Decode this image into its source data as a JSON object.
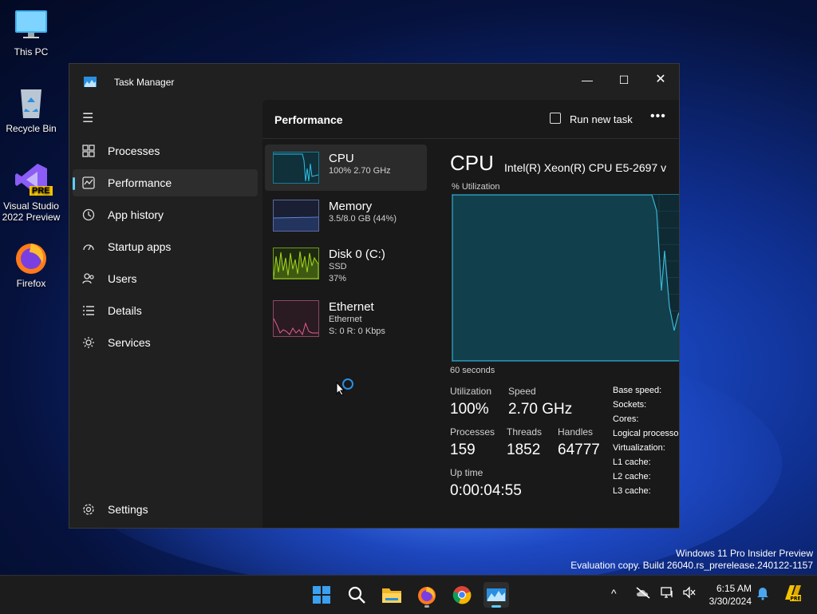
{
  "desktop": {
    "icons": [
      {
        "label": "This PC"
      },
      {
        "label": "Recycle Bin"
      },
      {
        "label": "Visual Studio 2022 Preview",
        "badge": "PRE"
      },
      {
        "label": "Firefox"
      }
    ],
    "watermark": {
      "line1": "Windows 11 Pro Insider Preview",
      "line2": "Evaluation copy. Build 26040.rs_prerelease.240122-1157"
    }
  },
  "window": {
    "title": "Task Manager",
    "controls": {
      "minimize": "—",
      "maximize": "☐",
      "close": "✕"
    }
  },
  "nav": {
    "hamburger": "☰",
    "items": [
      {
        "label": "Processes",
        "icon": "processes-grid-icon"
      },
      {
        "label": "Performance",
        "icon": "performance-chart-icon",
        "active": true
      },
      {
        "label": "App history",
        "icon": "history-clock-icon"
      },
      {
        "label": "Startup apps",
        "icon": "startup-gauge-icon"
      },
      {
        "label": "Users",
        "icon": "users-icon"
      },
      {
        "label": "Details",
        "icon": "details-list-icon"
      },
      {
        "label": "Services",
        "icon": "services-puzzle-icon"
      }
    ],
    "settings": "Settings"
  },
  "header": {
    "page_title": "Performance",
    "run_new_task": "Run new task",
    "more": "•••"
  },
  "resources": [
    {
      "name": "CPU",
      "sub1": "100%  2.70 GHz",
      "sub2": ""
    },
    {
      "name": "Memory",
      "sub1": "3.5/8.0 GB (44%)",
      "sub2": ""
    },
    {
      "name": "Disk 0 (C:)",
      "sub1": "SSD",
      "sub2": "37%"
    },
    {
      "name": "Ethernet",
      "sub1": "Ethernet",
      "sub2": "S: 0  R: 0 Kbps"
    }
  ],
  "detail": {
    "title": "CPU",
    "model": "Intel(R) Xeon(R) CPU E5-2697 v",
    "graph_label": "% Utilization",
    "time_label": "60 seconds",
    "utilization_label": "Utilization",
    "utilization_value": "100%",
    "speed_label": "Speed",
    "speed_value": "2.70 GHz",
    "processes_label": "Processes",
    "processes_value": "159",
    "threads_label": "Threads",
    "threads_value": "1852",
    "handles_label": "Handles",
    "handles_value": "64777",
    "uptime_label": "Up time",
    "uptime_value": "0:00:04:55",
    "specs": [
      "Base speed:",
      "Sockets:",
      "Cores:",
      "Logical processo",
      "Virtualization:",
      "L1 cache:",
      "L2 cache:",
      "L3 cache:"
    ]
  },
  "taskbar": {
    "apps": [
      "start-icon",
      "search-icon",
      "file-explorer-icon",
      "firefox-icon",
      "chrome-icon",
      "task-manager-icon"
    ],
    "tray": {
      "chevron": "^"
    },
    "time": "6:15 AM",
    "date": "3/30/2024"
  },
  "colors": {
    "accent": "#60cdff",
    "cpu_graph": "#18a0c8",
    "memory_graph": "#8a4fd0",
    "disk_graph": "#6cc00e",
    "ethernet_graph": "#d0568a"
  }
}
